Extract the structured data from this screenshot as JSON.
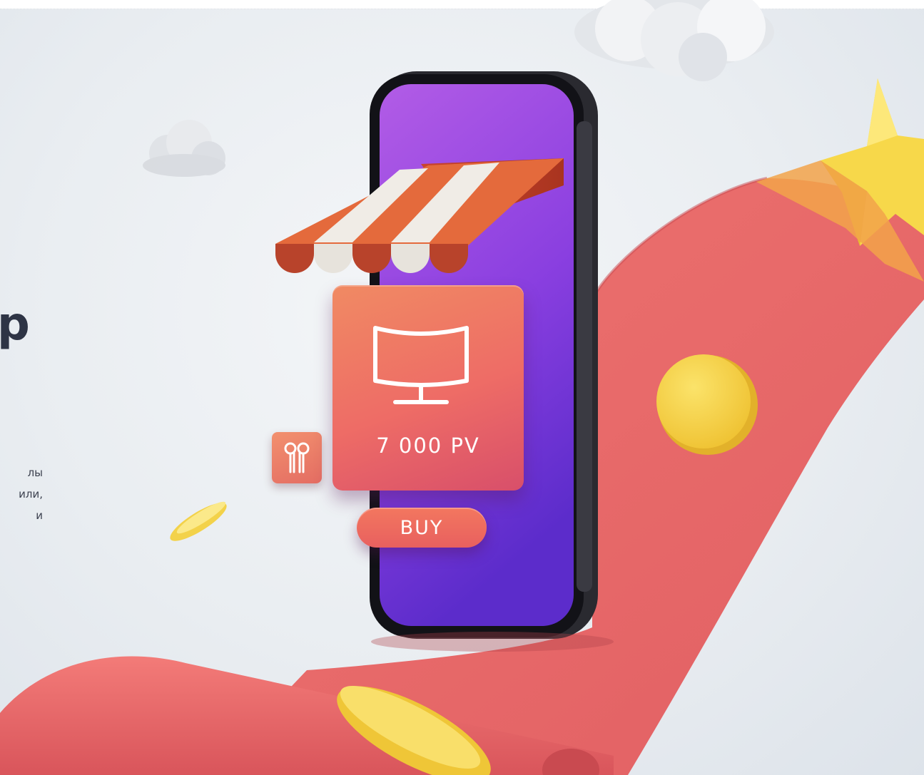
{
  "hero": {
    "heading_fragment": "p",
    "body_fragment_lines": [
      "лы",
      "или,",
      "и"
    ]
  },
  "product": {
    "icon": "curved-monitor-icon",
    "price": "7 000 PV",
    "buy_label": "BUY"
  },
  "side_product": {
    "icon": "earbuds-icon"
  },
  "colors": {
    "ribbon": "#e8696a",
    "phone_screen_top": "#a654e0",
    "phone_screen_bottom": "#6a2bd2",
    "card": "#ee6c66",
    "star": "#f7d84a",
    "coin": "#f4cf3e"
  }
}
